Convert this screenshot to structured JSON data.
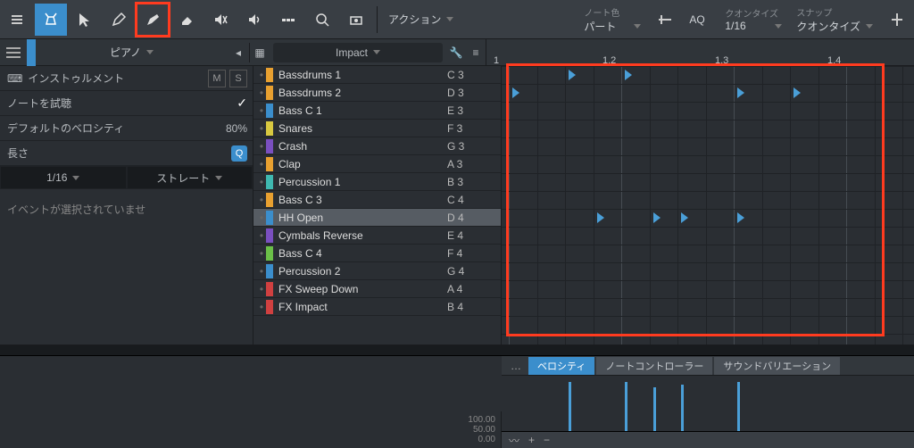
{
  "toolbar": {
    "action_label": "アクション",
    "note_color_label": "ノート色",
    "note_color_value": "パート",
    "aq_label": "AQ",
    "quantize_label": "クオンタイズ",
    "quantize_value": "1/16",
    "snap_label": "スナップ",
    "snap_value": "クオンタイズ"
  },
  "row2": {
    "piano": "ピアノ",
    "impact": "Impact"
  },
  "ruler": [
    "1",
    "1.2",
    "1.3",
    "1.4"
  ],
  "side": {
    "instrument": "インストゥルメント",
    "m": "M",
    "s": "S",
    "preview": "ノートを試聴",
    "def_velocity": "デフォルトのベロシティ",
    "def_velocity_val": "80%",
    "length": "長さ",
    "grid_val": "1/16",
    "swing": "ストレート",
    "no_selection": "イベントが選択されていませ"
  },
  "tracks": [
    {
      "name": "Bassdrums 1",
      "note": "C 3",
      "color": "c-orange",
      "sel": false
    },
    {
      "name": "Bassdrums 2",
      "note": "D 3",
      "color": "c-orange",
      "sel": false
    },
    {
      "name": "Bass C 1",
      "note": "E 3",
      "color": "c-blue",
      "sel": false
    },
    {
      "name": "Snares",
      "note": "F 3",
      "color": "c-yellow",
      "sel": false
    },
    {
      "name": "Crash",
      "note": "G 3",
      "color": "c-purple",
      "sel": false
    },
    {
      "name": "Clap",
      "note": "A 3",
      "color": "c-orange",
      "sel": false
    },
    {
      "name": "Percussion 1",
      "note": "B 3",
      "color": "c-cyan",
      "sel": false
    },
    {
      "name": "Bass C 3",
      "note": "C 4",
      "color": "c-orange",
      "sel": false
    },
    {
      "name": "HH Open",
      "note": "D 4",
      "color": "c-blue",
      "sel": true
    },
    {
      "name": "Cymbals Reverse",
      "note": "E 4",
      "color": "c-purple",
      "sel": false
    },
    {
      "name": "Bass C 4",
      "note": "F 4",
      "color": "c-green",
      "sel": false
    },
    {
      "name": "Percussion 2",
      "note": "G 4",
      "color": "c-blue",
      "sel": false
    },
    {
      "name": "FX Sweep Down",
      "note": "A 4",
      "color": "c-red",
      "sel": false
    },
    {
      "name": "FX Impact",
      "note": "B 4",
      "color": "c-red",
      "sel": false
    }
  ],
  "notes": [
    {
      "row": 0,
      "col": 2
    },
    {
      "row": 0,
      "col": 4
    },
    {
      "row": 1,
      "col": 0
    },
    {
      "row": 1,
      "col": 8
    },
    {
      "row": 1,
      "col": 10
    },
    {
      "row": 8,
      "col": 3
    },
    {
      "row": 8,
      "col": 5
    },
    {
      "row": 8,
      "col": 6
    },
    {
      "row": 8,
      "col": 8
    }
  ],
  "bottom": {
    "tabs": [
      "ベロシティ",
      "ノートコントローラー",
      "サウンドバリエーション"
    ],
    "vel_labels": [
      "100.00",
      "50.00",
      "0.00"
    ]
  },
  "velocity_bars": [
    {
      "col": 2,
      "h": 100
    },
    {
      "col": 4,
      "h": 100
    },
    {
      "col": 5,
      "h": 90
    },
    {
      "col": 6,
      "h": 95
    },
    {
      "col": 8,
      "h": 100
    }
  ],
  "chart_data": {
    "type": "bar",
    "title": "ベロシティ",
    "ylabel": "",
    "ylim": [
      0,
      100
    ],
    "categories": [
      2,
      4,
      5,
      6,
      8
    ],
    "values": [
      100,
      100,
      90,
      95,
      100
    ]
  }
}
